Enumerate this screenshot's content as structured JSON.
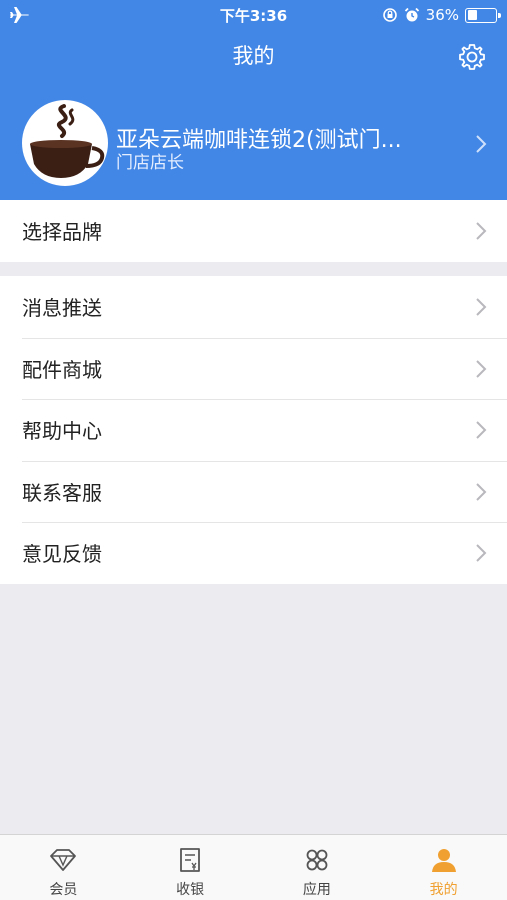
{
  "status_bar": {
    "time": "下午3:36",
    "battery": "36%",
    "battery_level": 0.36
  },
  "header": {
    "title": "我的"
  },
  "profile": {
    "name": "亚朵云端咖啡连锁2(测试门...",
    "role": "门店店长"
  },
  "brand_section": {
    "items": [
      {
        "label": "选择品牌"
      }
    ]
  },
  "menu": {
    "items": [
      {
        "label": "消息推送"
      },
      {
        "label": "配件商城"
      },
      {
        "label": "帮助中心"
      },
      {
        "label": "联系客服"
      },
      {
        "label": "意见反馈"
      }
    ]
  },
  "tabbar": {
    "items": [
      {
        "label": "会员",
        "icon": "diamond-icon"
      },
      {
        "label": "收银",
        "icon": "receipt-icon"
      },
      {
        "label": "应用",
        "icon": "apps-icon"
      },
      {
        "label": "我的",
        "icon": "person-icon",
        "active": true
      }
    ]
  },
  "colors": {
    "header_bg": "#4287e6",
    "active_tab": "#f0a030",
    "page_bg": "#ebebf0"
  }
}
